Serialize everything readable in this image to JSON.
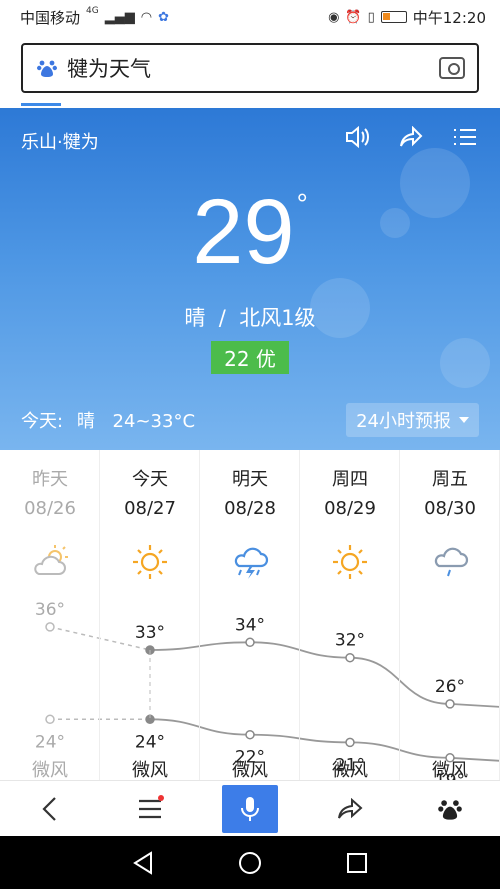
{
  "status_bar": {
    "carrier": "中国移动",
    "network": "4G",
    "time": "中午12:20"
  },
  "search": {
    "query": "犍为天气",
    "icons": [
      "baidu-paw-icon",
      "camera-icon"
    ]
  },
  "weather": {
    "location": "乐山·犍为",
    "temperature": "29",
    "degree_symbol": "°",
    "condition": "晴  /  北风1级",
    "aqi": "22 优",
    "today_label": "今天:",
    "today_condition": "晴",
    "today_range": "24~33°C",
    "hourly_button": "24小时预报",
    "accent_color": "#4cbc4b"
  },
  "forecast": {
    "days": [
      {
        "name": "昨天",
        "date": "08/26",
        "icon": "partly-sunny-icon",
        "high": "36°",
        "low": "24°",
        "wind": "微风",
        "past": true
      },
      {
        "name": "今天",
        "date": "08/27",
        "icon": "sunny-icon",
        "high": "33°",
        "low": "24°",
        "wind": "微风",
        "past": false
      },
      {
        "name": "明天",
        "date": "08/28",
        "icon": "thunderstorm-icon",
        "high": "34°",
        "low": "22°",
        "wind": "微风",
        "past": false
      },
      {
        "name": "周四",
        "date": "08/29",
        "icon": "sunny-icon",
        "high": "32°",
        "low": "21°",
        "wind": "微风",
        "past": false
      },
      {
        "name": "周五",
        "date": "08/30",
        "icon": "rain-icon",
        "high": "26°",
        "low": "19°",
        "wind": "微风",
        "past": false
      }
    ]
  },
  "bottom_bar": {
    "icons": [
      "back-icon",
      "menu-icon",
      "microphone-icon",
      "share-icon",
      "baidu-paw-icon"
    ]
  }
}
